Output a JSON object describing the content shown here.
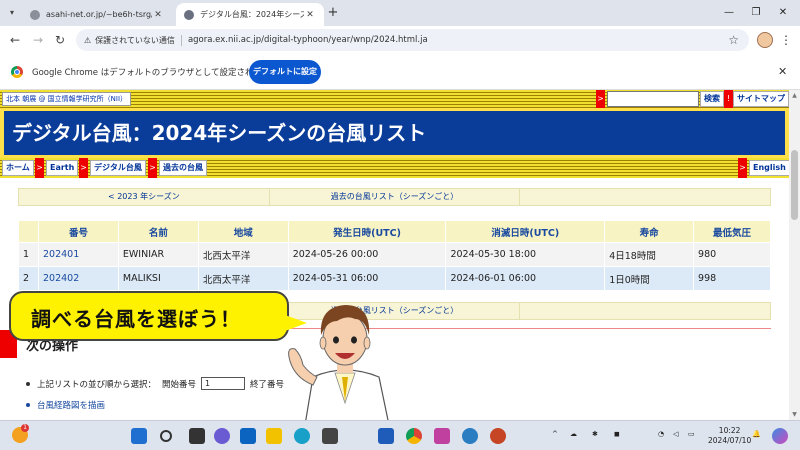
{
  "browser": {
    "tabs": [
      {
        "title": "asahi-net.or.jp/~be6h-tsrg/",
        "active": false
      },
      {
        "title": "デジタル台風：2024年シーズンの台",
        "active": true
      }
    ],
    "new_tab": "+",
    "address": {
      "security_label": "保護されていない通信",
      "url": "agora.ex.nii.ac.jp/digital-typhoon/year/wnp/2024.html.ja"
    },
    "infobar": {
      "message": "Google Chrome はデフォルトのブラウザとして設定されていません",
      "button": "デフォルトに設定"
    }
  },
  "site": {
    "user_link": "北本 朝展 @ 国立情報学研究所（NII）",
    "search_button": "検索",
    "sitemap_button": "サイトマップ",
    "page_title": "デジタル台風：2024年シーズンの台風リスト",
    "breadcrumbs": [
      "ホーム",
      "Earth",
      "デジタル台風",
      "過去の台風"
    ],
    "english_link": "English",
    "season_nav": {
      "prev": "< 2023 年シーズン",
      "list": "過去の台風リスト（シーズンごと）"
    },
    "table": {
      "headers": [
        "番号",
        "名前",
        "地域",
        "発生日時(UTC)",
        "消滅日時(UTC)",
        "寿命",
        "最低気圧"
      ],
      "rows": [
        {
          "idx": "1",
          "number": "202401",
          "name": "EWINIAR",
          "region": "北西太平洋",
          "start": "2024-05-26 00:00",
          "end": "2024-05-30 18:00",
          "life": "4日18時間",
          "pressure": "980"
        },
        {
          "idx": "2",
          "number": "202402",
          "name": "MALIKSI",
          "region": "北西太平洋",
          "start": "2024-05-31 06:00",
          "end": "2024-06-01 06:00",
          "life": "1日0時間",
          "pressure": "998"
        }
      ]
    },
    "next_ops": {
      "heading": "次の操作",
      "sort_prefix": "上記リストの並び順から選択：",
      "start_label": "開始番号",
      "start_value": "1",
      "end_label": "終了番号",
      "track_link": "台風経路図を描画"
    }
  },
  "overlay": {
    "callout": "調べる台風を選ぼう！"
  },
  "taskbar": {
    "badge": "1",
    "time": "10:22",
    "date": "2024/07/10"
  }
}
